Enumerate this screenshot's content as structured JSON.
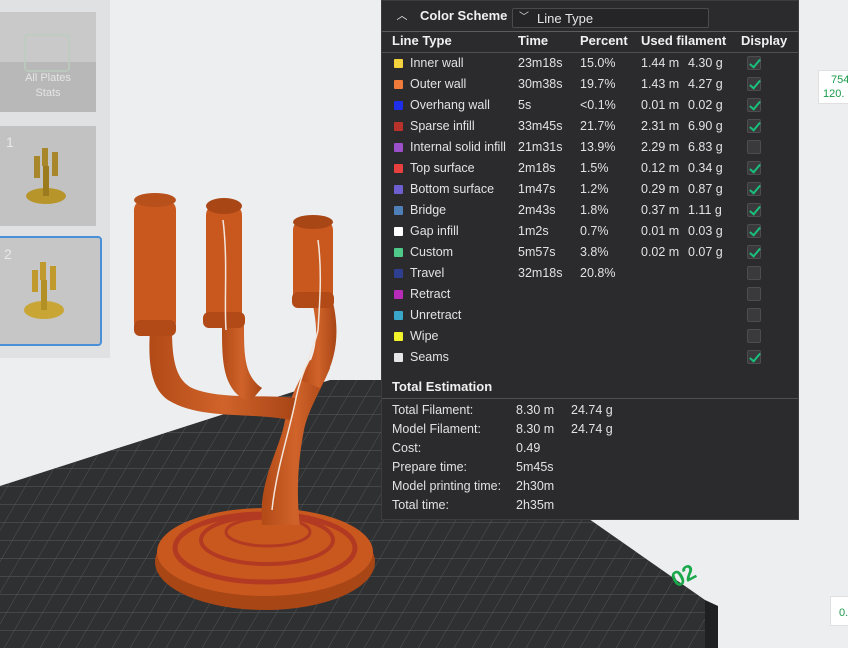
{
  "plates": {
    "all_label_line1": "All Plates",
    "all_label_line2": "Stats",
    "items": [
      {
        "number": "1"
      },
      {
        "number": "2"
      }
    ]
  },
  "color_scheme": {
    "title": "Color Scheme",
    "selected": "Line Type"
  },
  "columns": {
    "line_type": "Line Type",
    "time": "Time",
    "percent": "Percent",
    "used_filament": "Used filament",
    "display": "Display"
  },
  "line_types": [
    {
      "name": "Inner wall",
      "color": "#f5d33e",
      "time": "23m18s",
      "percent": "15.0%",
      "length": "1.44 m",
      "weight": "4.30 g",
      "display": true
    },
    {
      "name": "Outer wall",
      "color": "#f07a3a",
      "time": "30m38s",
      "percent": "19.7%",
      "length": "1.43 m",
      "weight": "4.27 g",
      "display": true
    },
    {
      "name": "Overhang wall",
      "color": "#1f2ee8",
      "time": "5s",
      "percent": "<0.1%",
      "length": "0.01 m",
      "weight": "0.02 g",
      "display": true
    },
    {
      "name": "Sparse infill",
      "color": "#b8322c",
      "time": "33m45s",
      "percent": "21.7%",
      "length": "2.31 m",
      "weight": "6.90 g",
      "display": true
    },
    {
      "name": "Internal solid infill",
      "color": "#9b4fc9",
      "time": "21m31s",
      "percent": "13.9%",
      "length": "2.29 m",
      "weight": "6.83 g",
      "display": false
    },
    {
      "name": "Top surface",
      "color": "#e8403e",
      "time": "2m18s",
      "percent": "1.5%",
      "length": "0.12 m",
      "weight": "0.34 g",
      "display": true
    },
    {
      "name": "Bottom surface",
      "color": "#6e5fd0",
      "time": "1m47s",
      "percent": "1.2%",
      "length": "0.29 m",
      "weight": "0.87 g",
      "display": true
    },
    {
      "name": "Bridge",
      "color": "#4f7fb8",
      "time": "2m43s",
      "percent": "1.8%",
      "length": "0.37 m",
      "weight": "1.11 g",
      "display": true
    },
    {
      "name": "Gap infill",
      "color": "#ffffff",
      "time": "1m2s",
      "percent": "0.7%",
      "length": "0.01 m",
      "weight": "0.03 g",
      "display": true
    },
    {
      "name": "Custom",
      "color": "#4fc98a",
      "time": "5m57s",
      "percent": "3.8%",
      "length": "0.02 m",
      "weight": "0.07 g",
      "display": true
    },
    {
      "name": "Travel",
      "color": "#2e3f8f",
      "time": "32m18s",
      "percent": "20.8%",
      "length": "",
      "weight": "",
      "display": false
    },
    {
      "name": "Retract",
      "color": "#b82ab8",
      "time": "",
      "percent": "",
      "length": "",
      "weight": "",
      "display": false
    },
    {
      "name": "Unretract",
      "color": "#3aa6c9",
      "time": "",
      "percent": "",
      "length": "",
      "weight": "",
      "display": false
    },
    {
      "name": "Wipe",
      "color": "#f2f22a",
      "time": "",
      "percent": "",
      "length": "",
      "weight": "",
      "display": false
    },
    {
      "name": "Seams",
      "color": "#e6e6e6",
      "time": "",
      "percent": "",
      "length": "",
      "weight": "",
      "display": true
    }
  ],
  "total": {
    "title": "Total Estimation",
    "rows": [
      {
        "label": "Total Filament:",
        "value1": "8.30 m",
        "value2": "24.74 g"
      },
      {
        "label": "Model Filament:",
        "value1": "8.30 m",
        "value2": "24.74 g"
      },
      {
        "label": "Cost:",
        "value1": "0.49",
        "value2": ""
      },
      {
        "label": "Prepare time:",
        "value1": "5m45s",
        "value2": ""
      },
      {
        "label": "Model printing time:",
        "value1": "2h30m",
        "value2": ""
      },
      {
        "label": "Total time:",
        "value1": "2h35m",
        "value2": ""
      }
    ]
  },
  "viewport": {
    "plate_number": "02",
    "coord_1": "754",
    "coord_2": "120.",
    "zoom_readout": "0."
  },
  "colors": {
    "model": "#c9581f",
    "bed": "#2f3032",
    "accent_green": "#19c07c"
  }
}
